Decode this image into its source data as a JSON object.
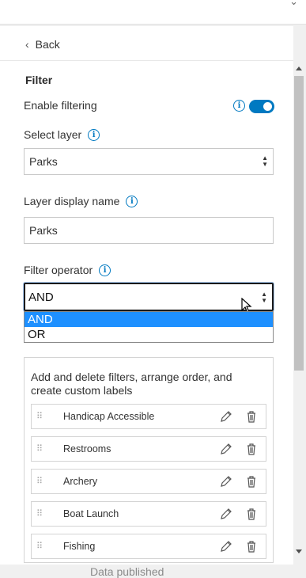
{
  "back_label": "Back",
  "section_title": "Filter",
  "enable_filtering": {
    "label": "Enable filtering",
    "enabled": true
  },
  "select_layer": {
    "label": "Select layer",
    "value": "Parks"
  },
  "layer_display_name": {
    "label": "Layer display name",
    "value": "Parks"
  },
  "filter_operator": {
    "label": "Filter operator",
    "value": "AND",
    "options": [
      {
        "label": "AND",
        "selected": true
      },
      {
        "label": "OR",
        "selected": false
      }
    ]
  },
  "filters_description": "Add and delete filters, arrange order, and create custom labels",
  "filters": [
    {
      "label": "Handicap Accessible"
    },
    {
      "label": "Restrooms"
    },
    {
      "label": "Archery"
    },
    {
      "label": "Boat Launch"
    },
    {
      "label": "Fishing"
    }
  ],
  "bottom_text": "Data published",
  "accent_color": "#0079c1",
  "selected_option_color": "#1e90ff"
}
